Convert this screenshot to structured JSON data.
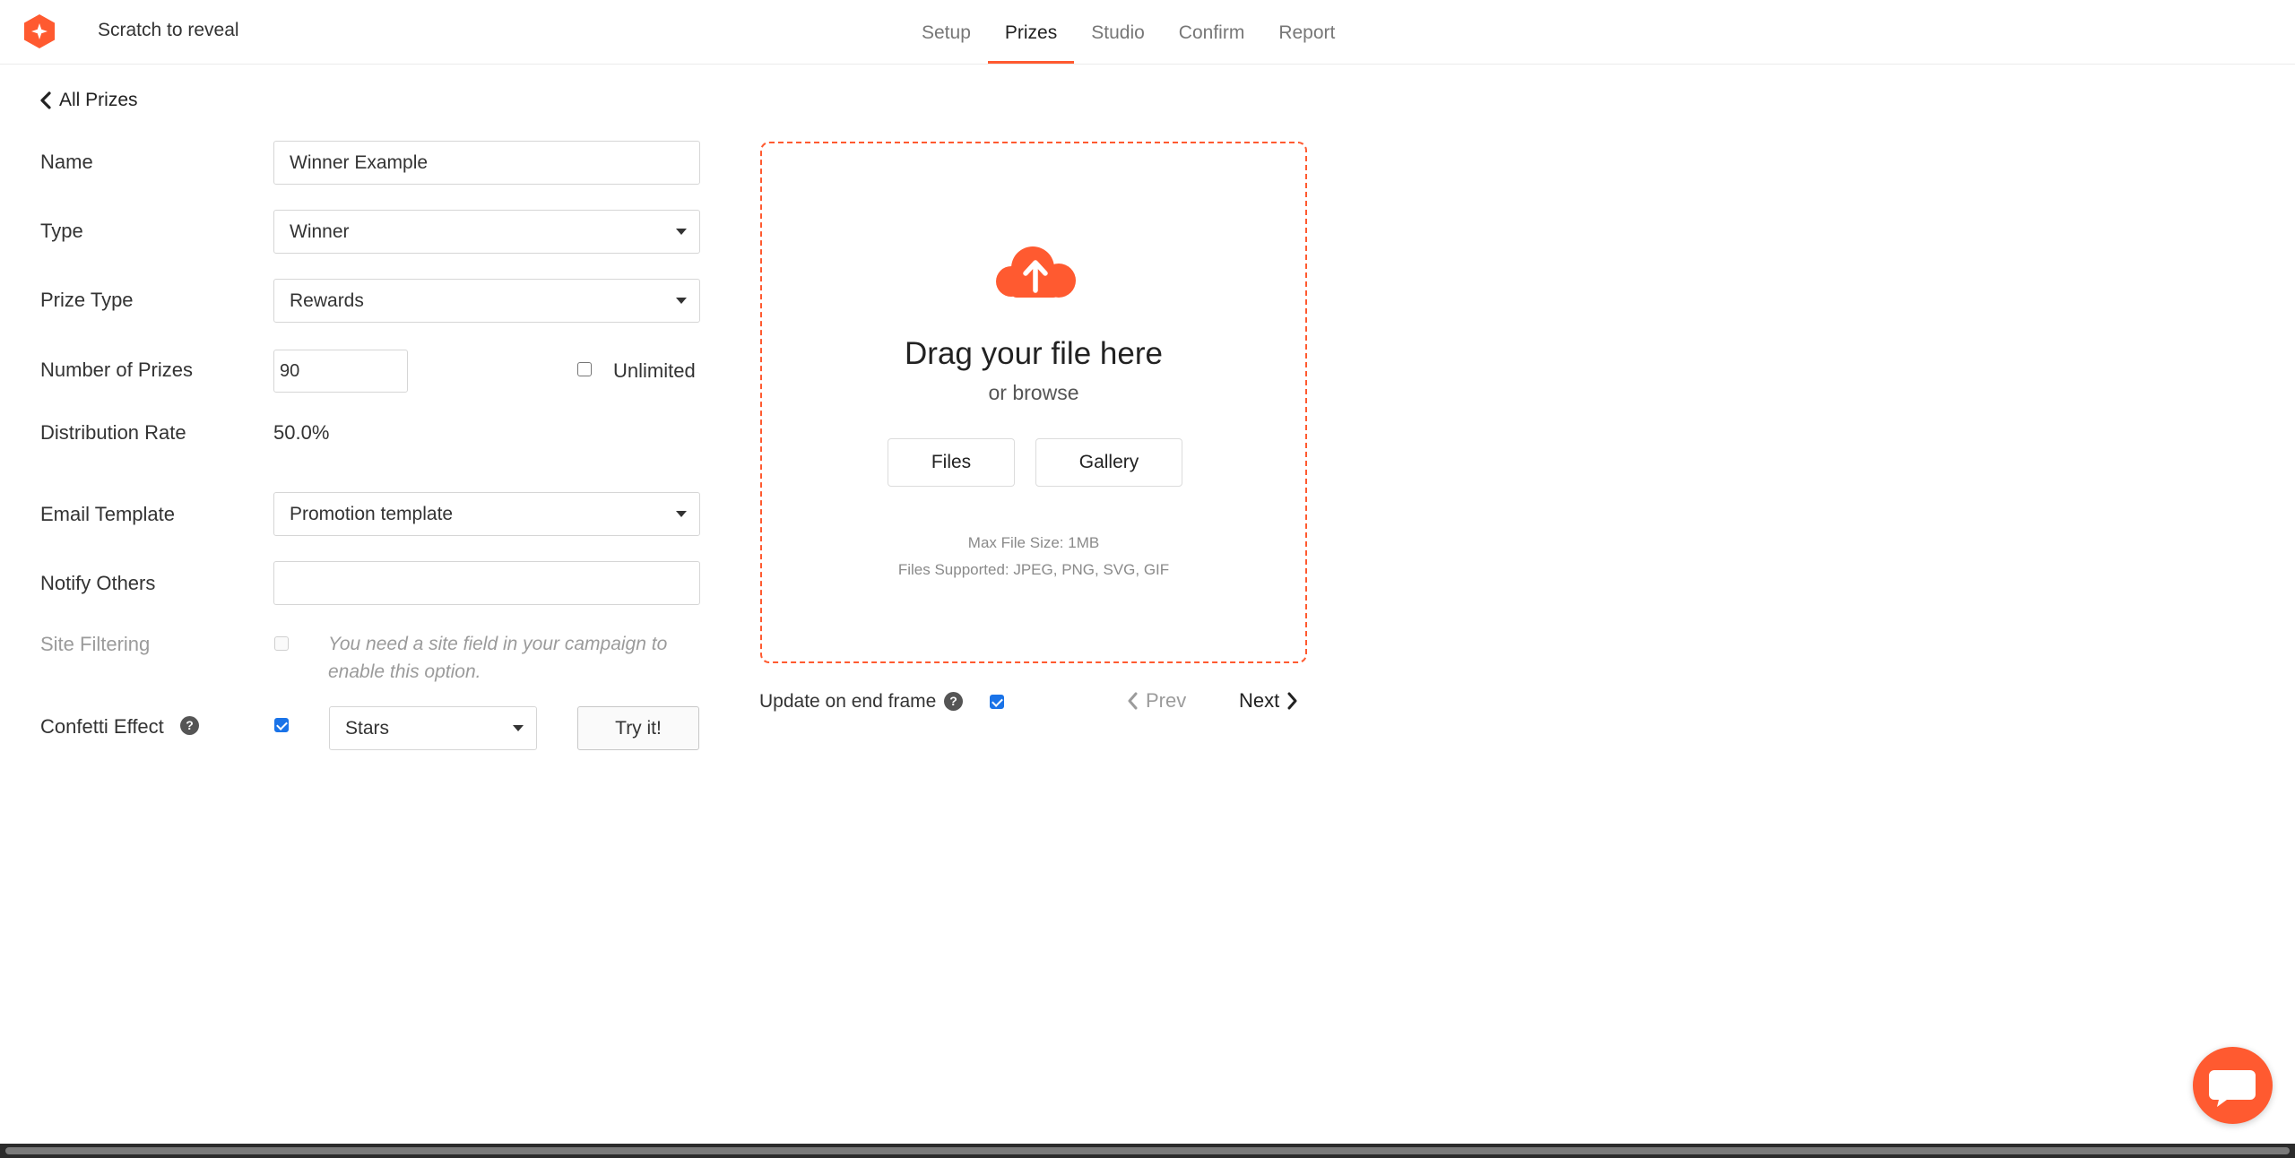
{
  "header": {
    "app_title": "Scratch to reveal",
    "tabs": [
      {
        "label": "Setup",
        "active": false
      },
      {
        "label": "Prizes",
        "active": true
      },
      {
        "label": "Studio",
        "active": false
      },
      {
        "label": "Confirm",
        "active": false
      },
      {
        "label": "Report",
        "active": false
      }
    ]
  },
  "nav": {
    "back_label": "All Prizes"
  },
  "form": {
    "name": {
      "label": "Name",
      "value": "Winner Example"
    },
    "type": {
      "label": "Type",
      "value": "Winner"
    },
    "prize_type": {
      "label": "Prize Type",
      "value": "Rewards"
    },
    "number_of_prizes": {
      "label": "Number of Prizes",
      "value": "90",
      "unlimited_label": "Unlimited",
      "unlimited_checked": false
    },
    "distribution_rate": {
      "label": "Distribution Rate",
      "value": "50.0%"
    },
    "email_template": {
      "label": "Email Template",
      "value": "Promotion template"
    },
    "notify_others": {
      "label": "Notify Others",
      "value": ""
    },
    "site_filtering": {
      "label": "Site Filtering",
      "hint": "You need a site field in your campaign to enable this option.",
      "enabled": false
    },
    "confetti": {
      "label": "Confetti Effect",
      "checked": true,
      "value": "Stars",
      "try_label": "Try it!"
    }
  },
  "upload": {
    "title": "Drag your file here",
    "subtitle": "or browse",
    "files_button": "Files",
    "gallery_button": "Gallery",
    "max_size": "Max File Size: 1MB",
    "supported": "Files Supported: JPEG, PNG, SVG, GIF"
  },
  "footer_controls": {
    "update_label": "Update on end frame",
    "update_checked": true,
    "prev_label": "Prev",
    "next_label": "Next"
  },
  "colors": {
    "accent": "#ff5a30",
    "checkbox": "#1a73e8"
  },
  "icons": {
    "logo": "app-logo-icon",
    "upload": "cloud-upload-icon",
    "chat": "chat-bubble-icon",
    "back": "chevron-left-icon",
    "next": "chevron-right-icon",
    "help": "question-circle-icon"
  }
}
